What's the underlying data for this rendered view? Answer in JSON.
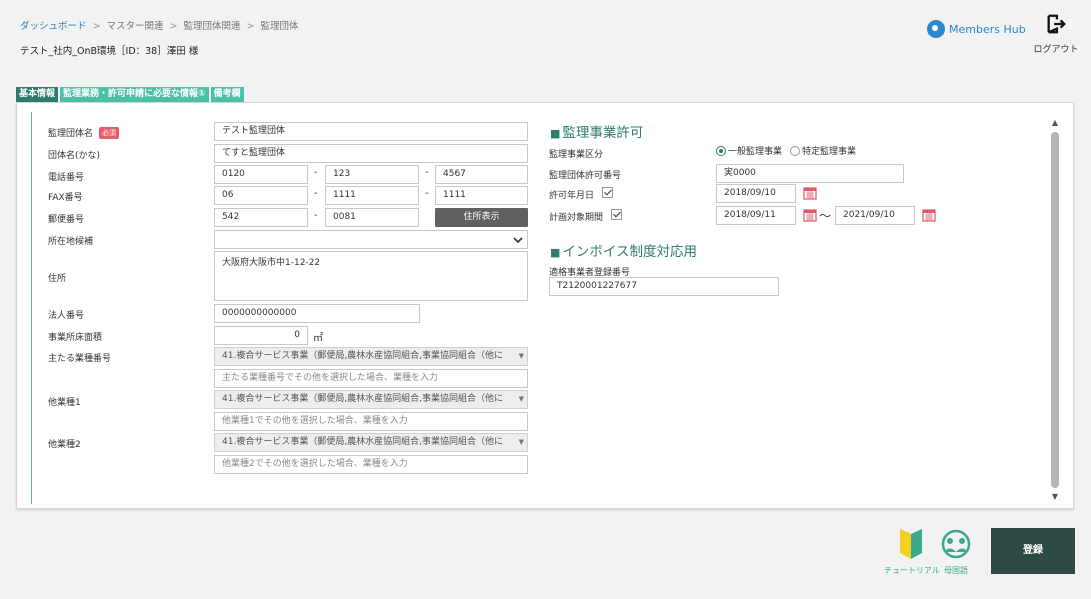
{
  "header": {
    "breadcrumb": [
      "ダッシュボード",
      "マスター関連",
      "監理団体関連",
      "監理団体"
    ],
    "breadcrumb_sep": ">",
    "user_line": "テスト_社内_OnB環境［ID：38］澤田 様",
    "brand_name": "Members Hub",
    "logout_label": "ログアウト"
  },
  "tabs": [
    "基本情報",
    "監理業務・許可申請に必要な情報①",
    "備考欄"
  ],
  "left": {
    "org_name_label": "監理団体名",
    "required_badge": "必須",
    "org_name_value": "テスト監理団体",
    "org_kana_label": "団体名(かな)",
    "org_kana_value": "てすと監理団体",
    "phone_label": "電話番号",
    "phone": [
      "0120",
      "123",
      "4567"
    ],
    "fax_label": "FAX番号",
    "fax": [
      "06",
      "1111",
      "1111"
    ],
    "postal_label": "郵便番号",
    "postal": [
      "542",
      "0081"
    ],
    "address_button": "住所表示",
    "address_candidate_label": "所在地候補",
    "address_label": "住所",
    "address_value": "大阪府大阪市中1-12-22",
    "corp_number_label": "法人番号",
    "corp_number_value": "0000000000000",
    "floor_area_label": "事業所床面積",
    "floor_area_value": "0",
    "floor_area_unit": "㎡",
    "main_industry_label": "主たる業種番号",
    "main_industry_value": "41.複合サービス事業（郵便局,農林水産協同組合,事業協同組合（他に",
    "main_industry_placeholder": "主たる業種番号でその他を選択した場合、業種を入力",
    "other1_label": "他業種1",
    "other1_value": "41.複合サービス事業（郵便局,農林水産協同組合,事業協同組合（他に",
    "other1_placeholder": "他業種1でその他を選択した場合、業種を入力",
    "other2_label": "他業種2",
    "other2_value": "41.複合サービス事業（郵便局,農林水産協同組合,事業協同組合（他に",
    "other2_placeholder": "他業種2でその他を選択した場合、業種を入力"
  },
  "right": {
    "license_title": "監理事業許可",
    "business_type_label": "監理事業区分",
    "radio_general": "一般監理事業",
    "radio_specific": "特定監理事業",
    "selected_type": "一般監理事業",
    "license_number_label": "監理団体許可番号",
    "license_number_value": "実0000",
    "permit_date_label": "許可年月日",
    "permit_date_value": "2018/09/10",
    "plan_period_label": "計画対象期間",
    "plan_start_value": "2018/09/11",
    "period_separator": "〜",
    "plan_end_value": "2021/09/10",
    "invoice_title": "インボイス制度対応用",
    "invoice_label": "適格事業者登録番号",
    "invoice_value": "T2120001227677"
  },
  "footer": {
    "tutorial_label": "チュートリアル",
    "language_label": "母国語",
    "register_label": "登録"
  },
  "colors": {
    "accent": "#2e7b6f",
    "tab": "#4cbfa8",
    "required": "#e35d6a",
    "register": "#2e4a46"
  }
}
